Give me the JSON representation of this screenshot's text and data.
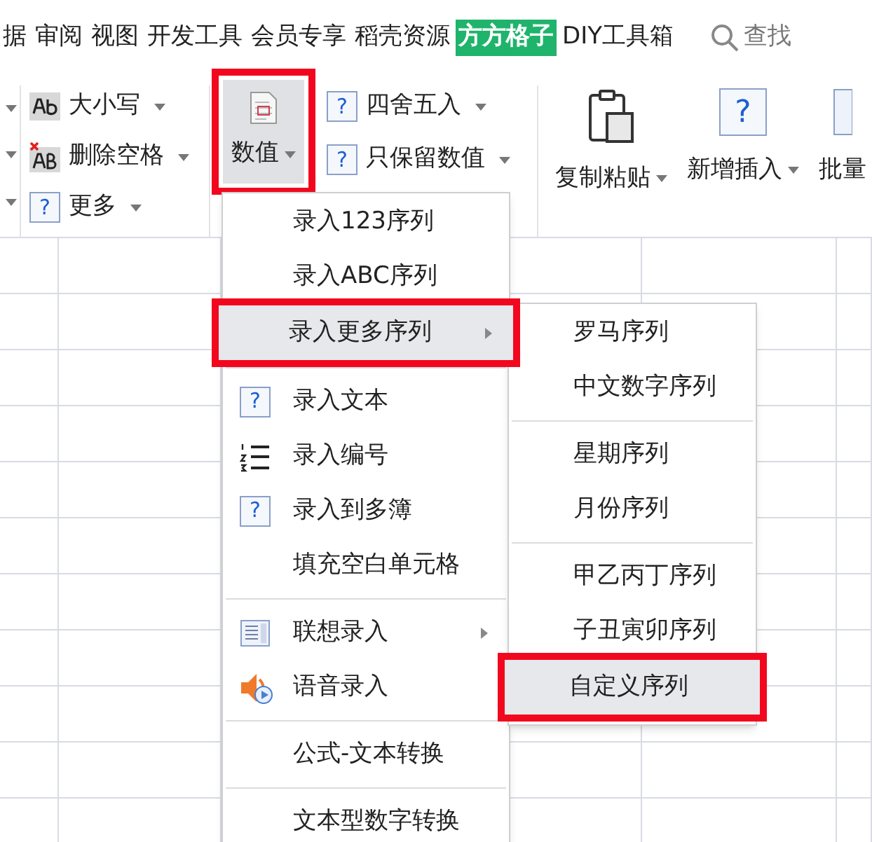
{
  "menu_tabs": [
    {
      "label": "据",
      "selected": false
    },
    {
      "label": "审阅",
      "selected": false
    },
    {
      "label": "视图",
      "selected": false
    },
    {
      "label": "开发工具",
      "selected": false
    },
    {
      "label": "会员专享",
      "selected": false
    },
    {
      "label": "稻壳资源",
      "selected": false
    },
    {
      "label": "方方格子",
      "selected": true
    },
    {
      "label": "DIY工具箱",
      "selected": false
    }
  ],
  "search": {
    "label": "查找"
  },
  "ribbon": {
    "small_column_1": [
      {
        "kind": "text-case",
        "label": "大小写"
      },
      {
        "kind": "delete-space",
        "label": "删除空格"
      },
      {
        "kind": "help",
        "glyph": "?",
        "label": "更多"
      }
    ],
    "number_button": {
      "label": "数值",
      "pressed": true,
      "highlighted": true
    },
    "small_column_2": [
      {
        "kind": "help",
        "glyph": "?",
        "label": "四舍五入"
      },
      {
        "kind": "help",
        "glyph": "?",
        "label": "只保留数值"
      }
    ],
    "large_buttons": [
      {
        "kind": "clipboard",
        "label": "复制粘贴"
      },
      {
        "kind": "help",
        "glyph": "?",
        "label": "新增插入"
      },
      {
        "kind": "list",
        "label": "批量"
      }
    ]
  },
  "dropdown": {
    "items": [
      {
        "kind": "plain",
        "label": "录入123序列",
        "selected": false
      },
      {
        "kind": "plain",
        "label": "录入ABC序列",
        "selected": false
      },
      {
        "kind": "plain",
        "label": "录入更多序列",
        "submenu": true,
        "selected": true,
        "highlighted": true
      },
      {
        "kind": "separator"
      },
      {
        "kind": "help",
        "glyph": "?",
        "label": "录入文本",
        "selected": false
      },
      {
        "kind": "numbered-list",
        "label": "录入编号",
        "selected": false
      },
      {
        "kind": "help",
        "glyph": "?",
        "label": "录入到多簿",
        "selected": false
      },
      {
        "kind": "plain",
        "label": "填充空白单元格",
        "selected": false
      },
      {
        "kind": "separator"
      },
      {
        "kind": "list",
        "label": "联想录入",
        "submenu": true,
        "selected": false
      },
      {
        "kind": "speaker",
        "label": "语音录入",
        "selected": false
      },
      {
        "kind": "separator"
      },
      {
        "kind": "plain",
        "label": "公式-文本转换",
        "selected": false
      },
      {
        "kind": "separator"
      },
      {
        "kind": "plain",
        "label": "文本型数字转换",
        "selected": false
      }
    ]
  },
  "submenu": {
    "items": [
      {
        "kind": "plain",
        "label": "罗马序列",
        "selected": false
      },
      {
        "kind": "plain",
        "label": "中文数字序列",
        "selected": false
      },
      {
        "kind": "separator"
      },
      {
        "kind": "plain",
        "label": "星期序列",
        "selected": false
      },
      {
        "kind": "plain",
        "label": "月份序列",
        "selected": false
      },
      {
        "kind": "separator"
      },
      {
        "kind": "plain",
        "label": "甲乙丙丁序列",
        "selected": false
      },
      {
        "kind": "plain",
        "label": "子丑寅卯序列",
        "selected": false
      },
      {
        "kind": "plain",
        "label": "自定义序列",
        "selected": true,
        "highlighted": true
      }
    ]
  }
}
